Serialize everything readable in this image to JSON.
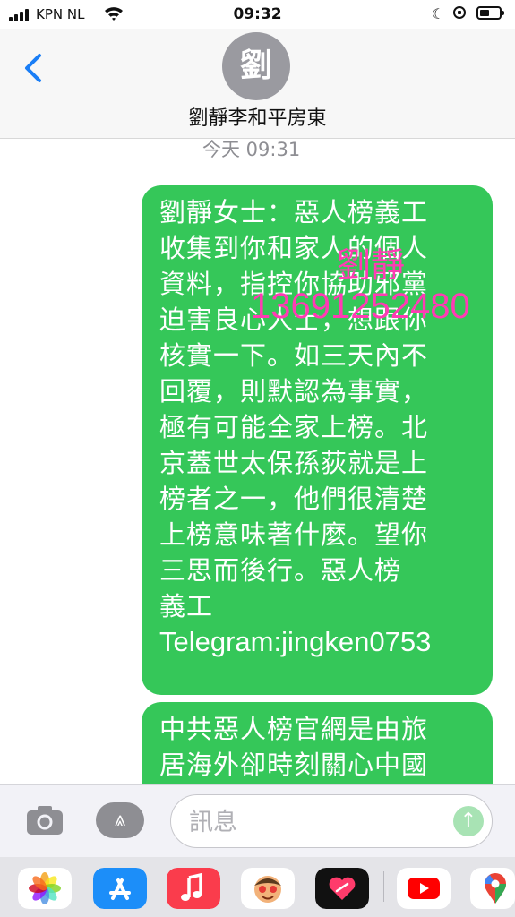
{
  "status_bar": {
    "carrier": "KPN NL",
    "time": "09:32"
  },
  "header": {
    "avatar_initial": "劉",
    "contact_name": "劉靜李和平房東"
  },
  "conversation": {
    "timestamp": "今天 09:31",
    "annotation_name": "劉靜",
    "annotation_phone": "13691252480",
    "message1_lines": [
      "劉靜女士：惡人榜義工",
      "收集到你和家人的個人",
      "資料，指控你協助邪黨",
      "迫害良心人士，想跟你",
      "核實一下。如三天內不",
      "回覆，則默認為事實，",
      "極有可能全家上榜。北",
      "京蓋世太保孫荻就是上",
      "榜者之一，他們很清楚",
      "上榜意味著什麼。望你",
      "三思而後行。惡人榜",
      "義工",
      "Telegram:jingken0753"
    ],
    "message2_lines": [
      "中共惡人榜官網是由旅",
      "居海外卻時刻關心中國"
    ],
    "bubble_color": "#35c759",
    "annotation_color": "#ff3bb4"
  },
  "input_bar": {
    "placeholder": "訊息",
    "value": ""
  },
  "app_drawer": {
    "apps": [
      "photos-icon",
      "app-store-icon",
      "music-icon",
      "memoji-icon",
      "digital-touch-icon",
      "youtube-icon",
      "google-maps-icon"
    ]
  }
}
